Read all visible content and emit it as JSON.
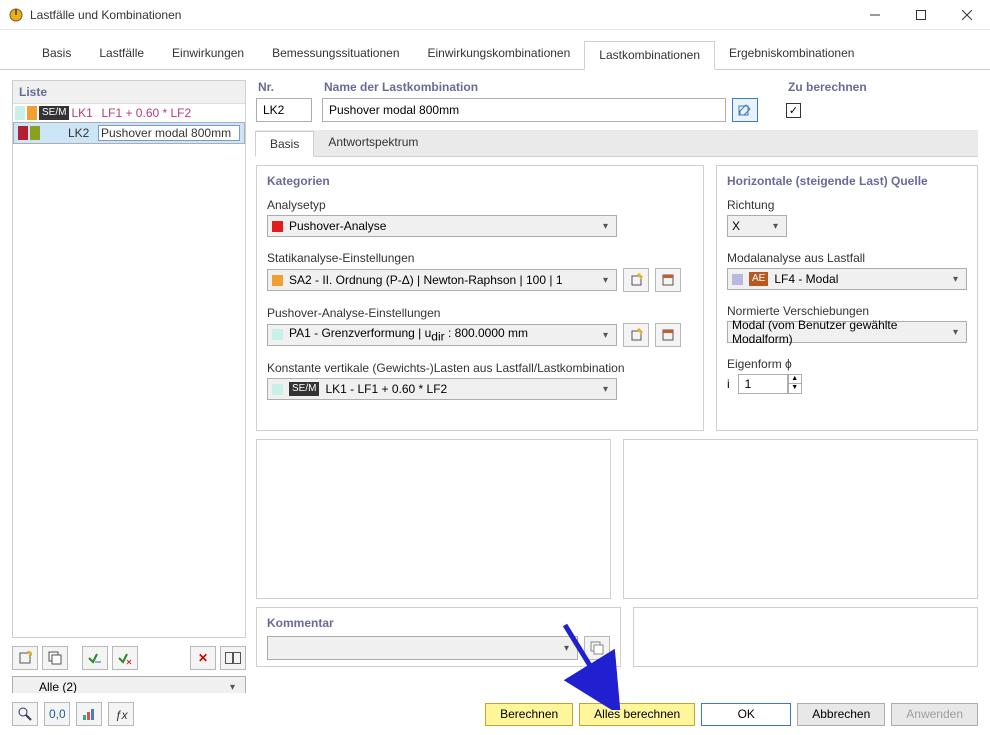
{
  "window": {
    "title": "Lastfälle und Kombinationen"
  },
  "tabs": {
    "items": [
      "Basis",
      "Lastfälle",
      "Einwirkungen",
      "Bemessungssituationen",
      "Einwirkungskombinationen",
      "Lastkombinationen",
      "Ergebniskombinationen"
    ],
    "active_index": 5
  },
  "list": {
    "header": "Liste",
    "rows": [
      {
        "tag": "SE/M",
        "lk": "LK1",
        "text": "LF1 + 0.60 * LF2",
        "swatches": [
          "#c8f0e8",
          "#f0a030"
        ],
        "selected": false,
        "textcolor": "#b83a7a"
      },
      {
        "tag": "",
        "lk": "LK2",
        "text": "Pushover modal 800mm",
        "swatches": [
          "#b02030",
          "#8aa020"
        ],
        "selected": true,
        "textcolor": "#333"
      }
    ],
    "filter": "Alle (2)"
  },
  "header_fields": {
    "nr_label": "Nr.",
    "nr_value": "LK2",
    "name_label": "Name der Lastkombination",
    "name_value": "Pushover modal 800mm",
    "calc_label": "Zu berechnen",
    "calc_checked": true
  },
  "subtabs": {
    "items": [
      "Basis",
      "Antwortspektrum"
    ],
    "active_index": 0
  },
  "leftgroup": {
    "title": "Kategorien",
    "analysetyp_label": "Analysetyp",
    "analysetyp_value": "Pushover-Analyse",
    "statik_label": "Statikanalyse-Einstellungen",
    "statik_value": "SA2 - II. Ordnung (P-Δ) | Newton-Raphson | 100 | 1",
    "push_label": "Pushover-Analyse-Einstellungen",
    "push_value": "PA1 - Grenzverformung | u",
    "push_sub": "dir",
    "push_tail": " : 800.0000 mm",
    "konst_label": "Konstante vertikale (Gewichts-)Lasten aus Lastfall/Lastkombination",
    "konst_tag": "SE/M",
    "konst_value": "LK1 - LF1 + 0.60 * LF2"
  },
  "rightgroup": {
    "title": "Horizontale (steigende Last) Quelle",
    "richtung_label": "Richtung",
    "richtung_value": "X",
    "modal_label": "Modalanalyse aus Lastfall",
    "modal_tag": "AE",
    "modal_value": "LF4 - Modal",
    "norm_label": "Normierte Verschiebungen",
    "norm_value": "Modal (vom Benutzer gewählte Modalform)",
    "eigen_label": "Eigenform ϕ",
    "eigen_i": "i",
    "eigen_value": "1"
  },
  "kommentar_label": "Kommentar",
  "buttons": {
    "berechnen": "Berechnen",
    "alles": "Alles berechnen",
    "ok": "OK",
    "abbrechen": "Abbrechen",
    "anwenden": "Anwenden"
  }
}
